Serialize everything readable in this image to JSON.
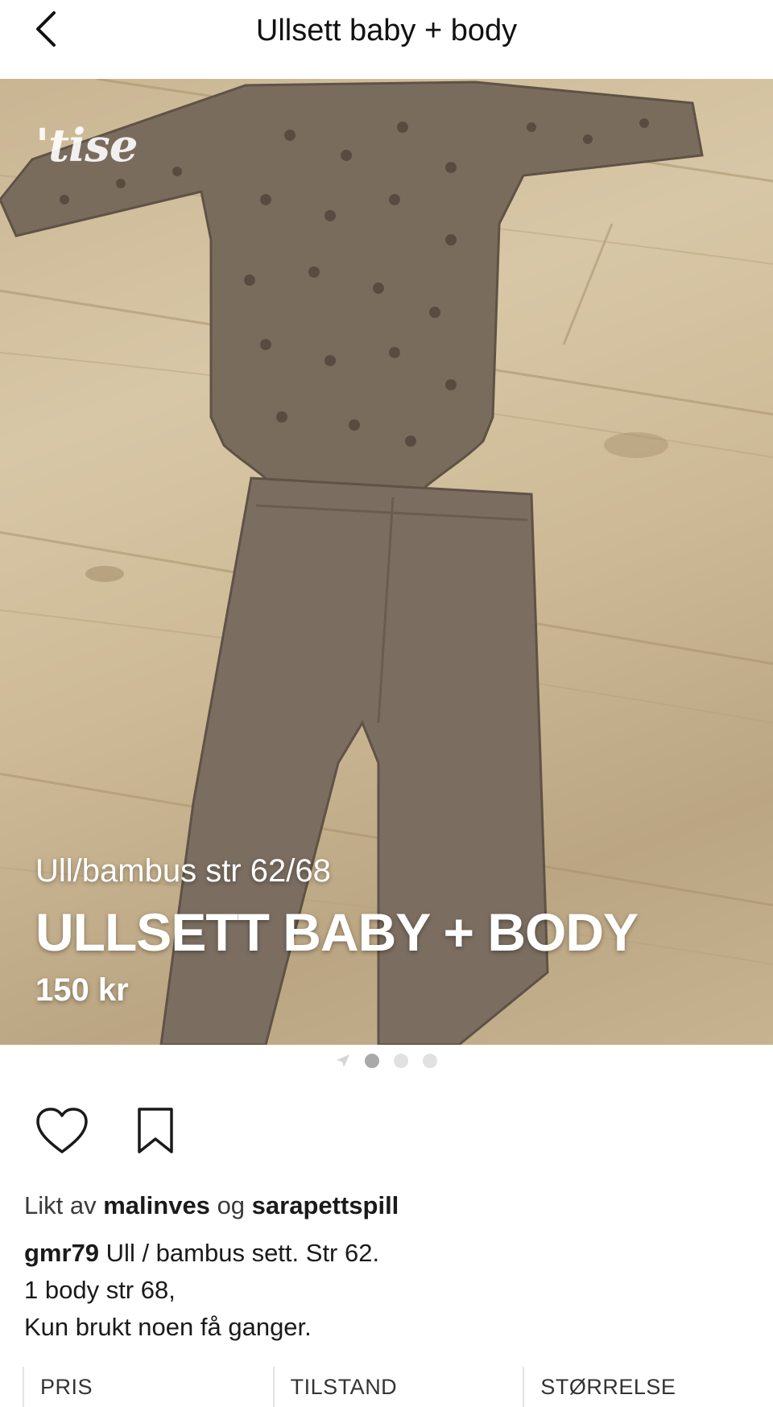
{
  "header": {
    "title": "Ullsett baby + body",
    "back_icon": "chevron-left-icon"
  },
  "hero": {
    "watermark": "'tise",
    "subtitle": "Ull/bambus str 62/68",
    "title": "ULLSETT BABY + BODY",
    "price": "150 kr"
  },
  "pager": {
    "count": 3,
    "active_index": 0
  },
  "actions": {
    "like_icon": "heart-icon",
    "save_icon": "bookmark-icon"
  },
  "likes": {
    "prefix": "Likt av",
    "user1": "malinves",
    "joiner": "og",
    "user2": "sarapettspill"
  },
  "description": {
    "user": "gmr79",
    "line1": "Ull / bambus sett. Str 62.",
    "line2": "1 body str 68,",
    "line3": "Kun brukt noen få ganger."
  },
  "specs": {
    "price_label": "PRIS",
    "condition_label": "TILSTAND",
    "size_label": "STØRRELSE"
  },
  "colors": {
    "text": "#1a1a1a",
    "muted": "#3a3a3a",
    "dot_active": "#a9a9a9",
    "dot_inactive": "#e1e1e1"
  }
}
